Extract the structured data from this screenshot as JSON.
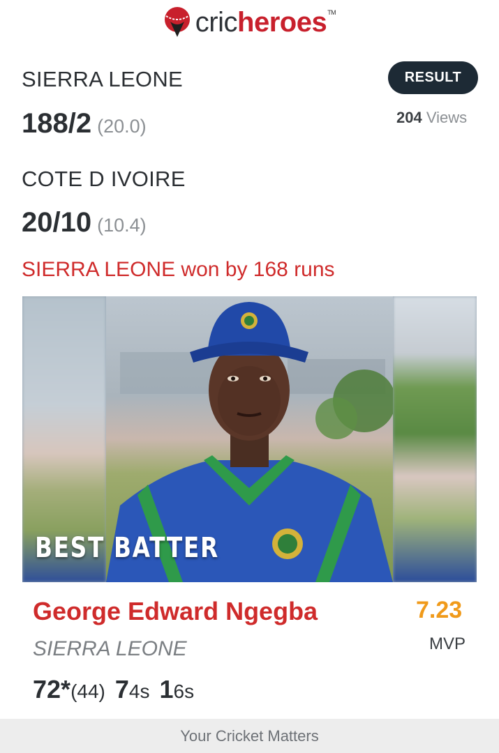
{
  "brand": {
    "part1": "cric",
    "part2": "heroes",
    "tm": "TM"
  },
  "match": {
    "team1": {
      "name": "SIERRA LEONE",
      "score": "188/2",
      "overs": "(20.0)"
    },
    "team2": {
      "name": "COTE D IVOIRE",
      "score": "20/10",
      "overs": "(10.4)"
    },
    "result_button": "RESULT",
    "views_count": "204",
    "views_label": "Views",
    "result_text": "SIERRA LEONE won by 168 runs"
  },
  "highlight": {
    "badge": "BEST BATTER",
    "player_name": "George Edward Ngegba",
    "player_team": "SIERRA LEONE",
    "mvp_value": "7.23",
    "mvp_label": "MVP",
    "runs": "72*",
    "balls": "(44)",
    "fours_count": "7",
    "fours_label": "4s",
    "sixes_count": "1",
    "sixes_label": "6s"
  },
  "footer": {
    "tagline": "Your Cricket Matters"
  },
  "colors": {
    "accent_red": "#cf2b2b",
    "mvp_orange": "#f09a1a",
    "button_dark": "#1d2a35"
  }
}
